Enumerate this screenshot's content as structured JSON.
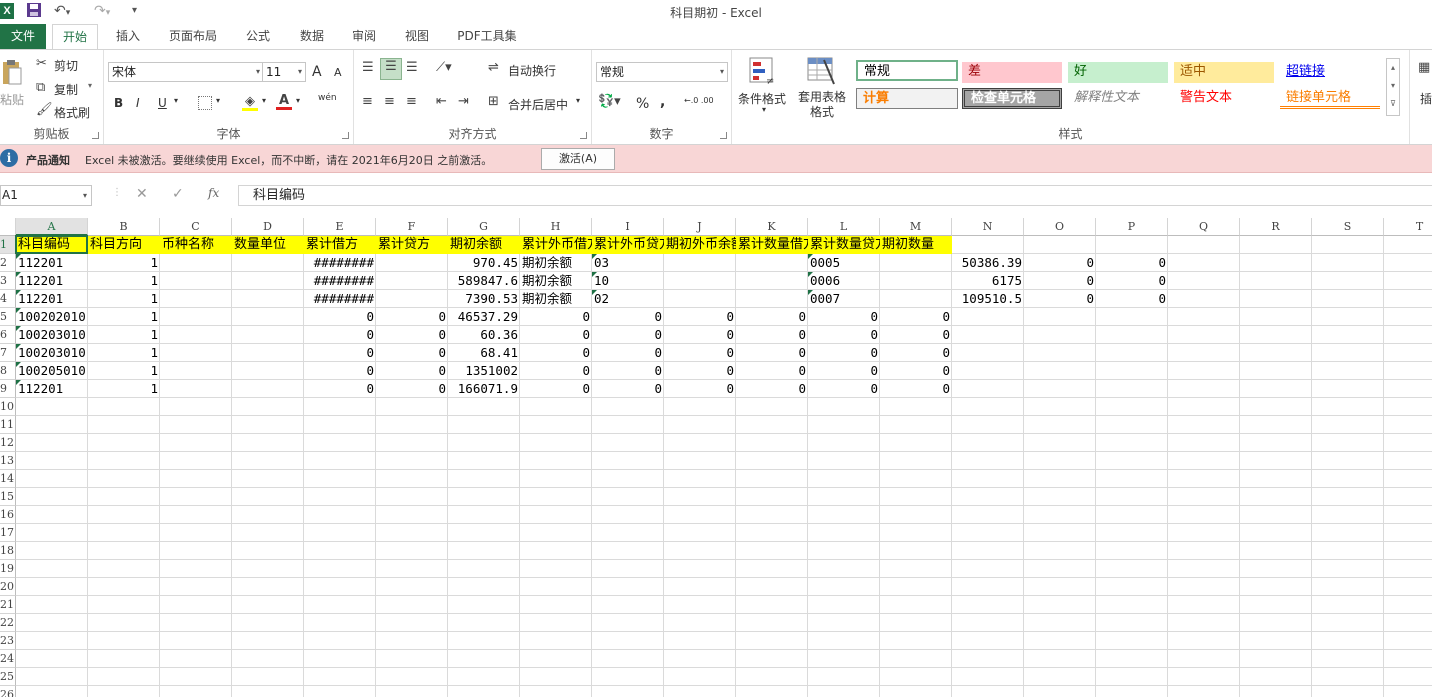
{
  "window": {
    "title": "科目期初 - Excel",
    "app_icon": "X"
  },
  "tabs": [
    "文件",
    "开始",
    "插入",
    "页面布局",
    "公式",
    "数据",
    "审阅",
    "视图",
    "PDF工具集"
  ],
  "ribbon": {
    "clipboard": {
      "paste": "粘贴",
      "cut": "剪切",
      "copy": "复制",
      "format_painter": "格式刷",
      "label": "剪贴板"
    },
    "font": {
      "name": "宋体",
      "size": "11",
      "label": "字体",
      "bold": "B",
      "italic": "I",
      "underline": "U",
      "grow": "A",
      "shrink": "A",
      "phonetic": "wén"
    },
    "alignment": {
      "wrap_text": "自动换行",
      "merge_center": "合并后居中",
      "label": "对齐方式"
    },
    "number": {
      "format": "常规",
      "label": "数字",
      "percent": "%",
      "comma": ",",
      "inc_decimal": "←.0 .00",
      "dec_decimal": ".00 →.0"
    },
    "styles": {
      "conditional": "条件格式",
      "table_format": "套用表格格式",
      "cell_styles": [
        "常规",
        "差",
        "好",
        "适中",
        "超链接",
        "计算",
        "检查单元格",
        "解释性文本",
        "警告文本",
        "链接单元格"
      ],
      "label": "样式"
    },
    "insert": "插"
  },
  "infobar": {
    "title": "产品通知",
    "message": "Excel 未被激活。要继续使用 Excel，而不中断，请在 2021年6月20日 之前激活。",
    "button": "激活(A)"
  },
  "formula_bar": {
    "name_box": "A1",
    "formula": "科目编码",
    "fx": "fx"
  },
  "sheet": {
    "columns": [
      "A",
      "B",
      "C",
      "D",
      "E",
      "F",
      "G",
      "H",
      "I",
      "J",
      "K",
      "L",
      "M",
      "N",
      "O",
      "P",
      "Q",
      "R",
      "S",
      "T"
    ],
    "row_numbers": [
      "1",
      "2",
      "3",
      "4",
      "5",
      "6",
      "7",
      "8",
      "9",
      "10",
      "11",
      "12",
      "13",
      "14",
      "15",
      "16",
      "17",
      "18",
      "19",
      "20",
      "21",
      "22",
      "23",
      "24",
      "25",
      "26"
    ],
    "headers": [
      "科目编码",
      "科目方向",
      "币种名称",
      "数量单位",
      "累计借方",
      "累计贷方",
      "期初余额",
      "累计外币借方",
      "累计外币贷方",
      "期初外币余额",
      "累计数量借方",
      "累计数量贷方",
      "期初数量"
    ],
    "rows": [
      [
        "112201",
        "1",
        "",
        "",
        "########",
        "",
        "970.45",
        "期初余额",
        "03",
        "",
        "",
        "0005",
        "",
        "50386.39",
        "0",
        "0"
      ],
      [
        "112201",
        "1",
        "",
        "",
        "########",
        "",
        "589847.6",
        "期初余额",
        "10",
        "",
        "",
        "0006",
        "",
        "6175",
        "0",
        "0"
      ],
      [
        "112201",
        "1",
        "",
        "",
        "########",
        "",
        "7390.53",
        "期初余额",
        "02",
        "",
        "",
        "0007",
        "",
        "109510.5",
        "0",
        "0"
      ],
      [
        "100202010",
        "1",
        "",
        "",
        "0",
        "0",
        "46537.29",
        "0",
        "0",
        "0",
        "0",
        "0",
        "0",
        "",
        "",
        ""
      ],
      [
        "100203010",
        "1",
        "",
        "",
        "0",
        "0",
        "60.36",
        "0",
        "0",
        "0",
        "0",
        "0",
        "0",
        "",
        "",
        ""
      ],
      [
        "100203010",
        "1",
        "",
        "",
        "0",
        "0",
        "68.41",
        "0",
        "0",
        "0",
        "0",
        "0",
        "0",
        "",
        "",
        ""
      ],
      [
        "100205010",
        "1",
        "",
        "",
        "0",
        "0",
        "1351002",
        "0",
        "0",
        "0",
        "0",
        "0",
        "0",
        "",
        "",
        ""
      ],
      [
        "112201",
        "1",
        "",
        "",
        "0",
        "0",
        "166071.9",
        "0",
        "0",
        "0",
        "0",
        "0",
        "0",
        "",
        "",
        ""
      ]
    ]
  }
}
